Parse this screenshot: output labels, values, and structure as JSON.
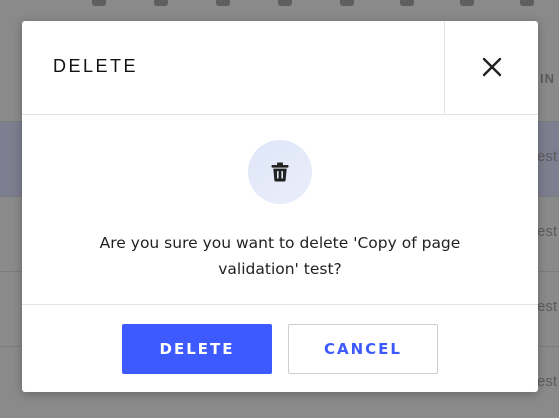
{
  "dialog": {
    "title": "DELETE",
    "close_icon": "close-icon",
    "body_icon": "trash-icon",
    "message": "Are you sure you want to delete 'Copy of page validation' test?",
    "confirm_label": "DELETE",
    "cancel_label": "CANCEL"
  },
  "background": {
    "header_fragment": "IN",
    "row_fragments": [
      "est",
      "est",
      "est",
      "est"
    ]
  },
  "colors": {
    "accent": "#3d5afe",
    "overlay": "#8a8a8a",
    "icon_circle": "#e3e9f8",
    "text": "#222222"
  }
}
